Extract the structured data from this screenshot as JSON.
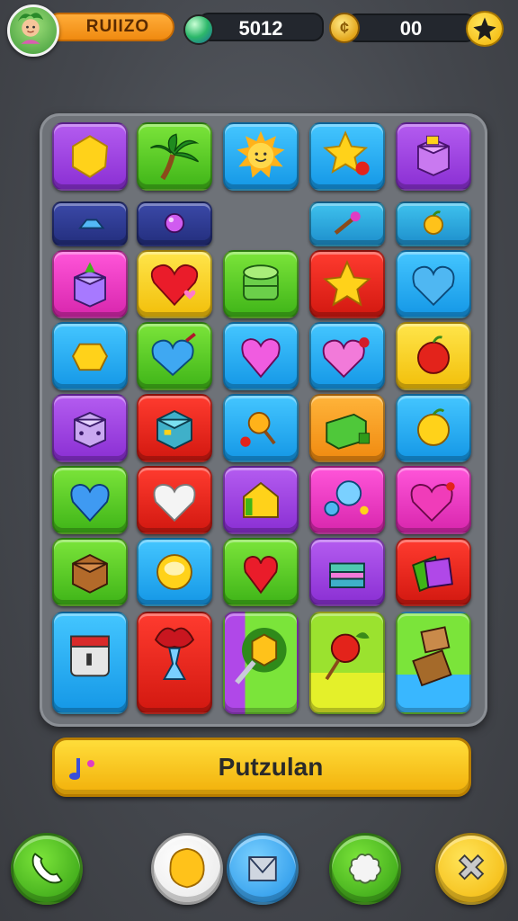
{
  "hud": {
    "player_name": "RUIIZO",
    "gems": "5012",
    "coins": "00",
    "plus_label": "+"
  },
  "board": {
    "rows": [
      [
        "yellow-hexagon-gem",
        "palm-tree",
        "sun-face",
        "star-with-apple",
        "purple-gift-box"
      ],
      [
        "blue-crystal-chip",
        "purple-orb",
        "",
        "magic-wand",
        "golden-apple"
      ],
      [
        "gift-box",
        "red-heart",
        "green-barrel",
        "gold-star",
        "blue-heart"
      ],
      [
        "yellow-gem",
        "blue-heart-bow",
        "pink-heart",
        "pink-heart-berry",
        "red-apple"
      ],
      [
        "purple-dice",
        "teal-cube",
        "lollipop",
        "green-gift-box",
        "golden-apple"
      ],
      [
        "blue-heart",
        "white-heart",
        "yellow-house",
        "blue-bubbles",
        "magenta-heart"
      ],
      [
        "brown-crate",
        "gold-coin",
        "red-heart",
        "layered-cake-box",
        "magic-books"
      ],
      [
        "calendar",
        "red-fountain",
        "yellow-cube-key",
        "red-apple-stick",
        "wooden-blocks"
      ]
    ]
  },
  "banner": {
    "label": "Putzulan",
    "icon": "music-note-icon"
  },
  "bottom_buttons": [
    {
      "name": "phone-button",
      "icon": "phone-icon"
    },
    {
      "name": "coin-button",
      "icon": "coin-icon"
    },
    {
      "name": "mail-button",
      "icon": "envelope-icon"
    },
    {
      "name": "flower-button",
      "icon": "flower-icon"
    },
    {
      "name": "close-button",
      "icon": "close-icon"
    }
  ],
  "colors": {
    "background": "#44474d",
    "board": "#6e7278",
    "banner": "#f2b00a",
    "name_pill": "#f08a10"
  }
}
